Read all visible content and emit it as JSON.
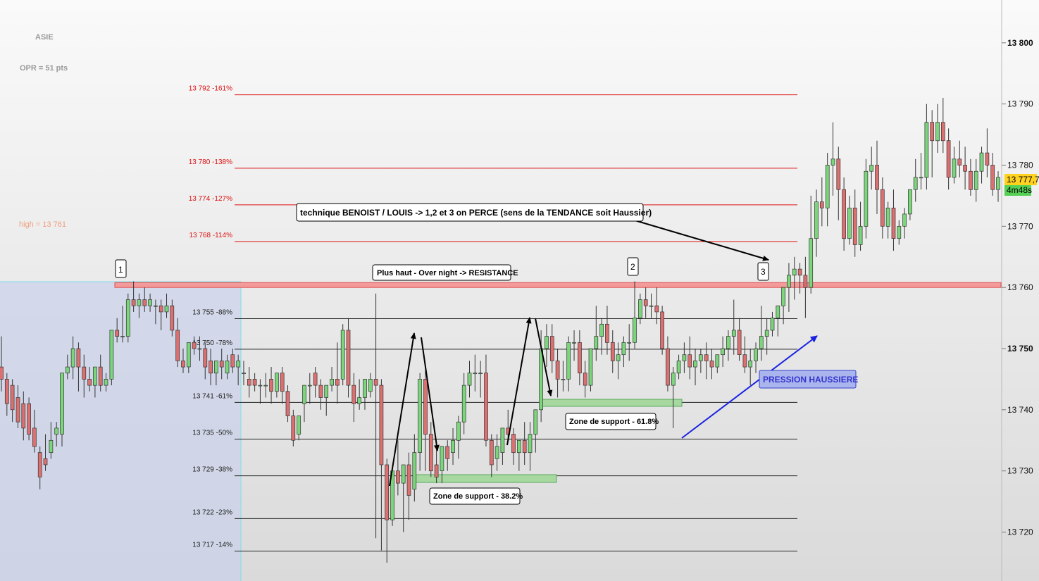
{
  "chart_data": {
    "type": "candlestick",
    "y_axis": {
      "range": [
        13712,
        13807
      ],
      "ticks": [
        {
          "value": 13800,
          "label": "13 800",
          "bold": true
        },
        {
          "value": 13790,
          "label": "13 790",
          "bold": false
        },
        {
          "value": 13780,
          "label": "13 780",
          "bold": false
        },
        {
          "value": 13770,
          "label": "13 770",
          "bold": false
        },
        {
          "value": 13760,
          "label": "13 760",
          "bold": false
        },
        {
          "value": 13750,
          "label": "13 750",
          "bold": true
        },
        {
          "value": 13740,
          "label": "13 740",
          "bold": false
        },
        {
          "value": 13730,
          "label": "13 730",
          "bold": false
        },
        {
          "value": 13720,
          "label": "13 720",
          "bold": false
        }
      ]
    },
    "session_label": "ASIE",
    "opr_label": "OPR = 51 pts",
    "high_label": "high = 13 761",
    "current_price": {
      "label": "13 777,7",
      "value": 13777.7
    },
    "countdown": "4m48s",
    "resistance_level": 13760.4,
    "levels": [
      {
        "label": "13 792 -161%",
        "value": 13791.5,
        "color": "red"
      },
      {
        "label": "13 780 -138%",
        "value": 13779.5,
        "color": "red"
      },
      {
        "label": "13 774 -127%",
        "value": 13773.5,
        "color": "red"
      },
      {
        "label": "13 768 -114%",
        "value": 13767.5,
        "color": "red"
      },
      {
        "label": "13 755 -88%",
        "value": 13754.9,
        "color": "black"
      },
      {
        "label": "13 750 -78%",
        "value": 13749.9,
        "color": "black"
      },
      {
        "label": "13 741 -61%",
        "value": 13741.2,
        "color": "black"
      },
      {
        "label": "13 735 -50%",
        "value": 13735.2,
        "color": "black"
      },
      {
        "label": "13 729 -38%",
        "value": 13729.2,
        "color": "black"
      },
      {
        "label": "13 722 -23%",
        "value": 13722.2,
        "color": "black"
      },
      {
        "label": "13 717 -14%",
        "value": 13716.9,
        "color": "black"
      }
    ],
    "annotations": {
      "technique": "technique BENOIST / LOUIS  -> 1,2 et 3 on PERCE (sens de la TENDANCE soit Haussier)",
      "resistance": "Plus haut - Over night -> RESISTANCE",
      "support_618": "Zone de support - 61.8%",
      "support_382": "Zone de support - 38.2%",
      "pression": "PRESSION HAUSSIERE",
      "markers": [
        "1",
        "2",
        "3"
      ]
    },
    "candles": [
      [
        13747,
        13752,
        13745,
        13743
      ],
      [
        13745,
        13746,
        13741,
        13739
      ],
      [
        13744,
        13745,
        13740,
        13738
      ],
      [
        13742,
        13744,
        13738,
        13737
      ],
      [
        13741,
        13743,
        13737,
        13735
      ],
      [
        13741,
        13742,
        13736,
        13735
      ],
      [
        13737,
        13740,
        13734,
        13733
      ],
      [
        13733,
        13734,
        13729,
        13727
      ],
      [
        13732,
        13736,
        13731,
        13730
      ],
      [
        13733,
        13738,
        13735,
        13732
      ],
      [
        13736,
        13738,
        13737,
        13734
      ],
      [
        13736,
        13742,
        13746,
        13734
      ],
      [
        13746,
        13749,
        13747,
        13745
      ],
      [
        13747,
        13752,
        13750,
        13745
      ],
      [
        13750,
        13751,
        13747,
        13743
      ],
      [
        13747,
        13749,
        13745,
        13742
      ],
      [
        13745,
        13747,
        13744,
        13743
      ],
      [
        13744,
        13746,
        13747,
        13742
      ],
      [
        13747,
        13749,
        13744,
        13743
      ],
      [
        13744,
        13746,
        13745,
        13743
      ],
      [
        13745,
        13753,
        13753,
        13744
      ],
      [
        13753,
        13755,
        13752,
        13751
      ],
      [
        13752,
        13757,
        13752,
        13751
      ],
      [
        13752,
        13759,
        13758,
        13751
      ],
      [
        13758,
        13761,
        13757,
        13756
      ],
      [
        13757,
        13759,
        13758,
        13755
      ],
      [
        13758,
        13760,
        13757,
        13756
      ],
      [
        13757,
        13759,
        13758,
        13756
      ],
      [
        13757,
        13758,
        13757,
        13754
      ],
      [
        13757,
        13758,
        13756,
        13753
      ],
      [
        13756,
        13759,
        13757,
        13755
      ],
      [
        13757,
        13758,
        13753,
        13752
      ],
      [
        13753,
        13755,
        13748,
        13747
      ],
      [
        13748,
        13750,
        13747,
        13746
      ],
      [
        13747,
        13751,
        13751,
        13746
      ],
      [
        13751,
        13752,
        13750,
        13749
      ],
      [
        13750,
        13752,
        13750,
        13748
      ],
      [
        13750,
        13751,
        13747,
        13745
      ],
      [
        13748,
        13750,
        13746,
        13744
      ],
      [
        13746,
        13747,
        13748,
        13744
      ],
      [
        13748,
        13750,
        13747,
        13745
      ],
      [
        13746,
        13749,
        13748,
        13745
      ],
      [
        13749,
        13750,
        13747,
        13746
      ],
      [
        13747,
        13749,
        13748,
        13744
      ],
      [
        13746,
        13748,
        13746,
        13744
      ],
      [
        13745,
        13747,
        13744,
        13742
      ],
      [
        13745,
        13746,
        13744,
        13743
      ],
      [
        13744,
        13745,
        13744,
        13741
      ],
      [
        13744,
        13746,
        13744,
        13742
      ],
      [
        13745,
        13747,
        13743,
        13741
      ],
      [
        13743,
        13746,
        13746,
        13742
      ],
      [
        13746,
        13747,
        13743,
        13741
      ],
      [
        13743,
        13744,
        13739,
        13738
      ],
      [
        13739,
        13740,
        13735,
        13734
      ],
      [
        13736,
        13739,
        13739,
        13735
      ],
      [
        13741,
        13742,
        13744,
        13738
      ],
      [
        13744,
        13746,
        13744,
        13741
      ],
      [
        13746,
        13747,
        13744,
        13742
      ],
      [
        13744,
        13745,
        13742,
        13740
      ],
      [
        13742,
        13744,
        13744,
        13739
      ],
      [
        13744,
        13747,
        13745,
        13743
      ],
      [
        13745,
        13751,
        13744,
        13741
      ],
      [
        13745,
        13754,
        13753,
        13744
      ],
      [
        13753,
        13755,
        13744,
        13742
      ],
      [
        13744,
        13746,
        13741,
        13738
      ],
      [
        13741,
        13745,
        13742,
        13740
      ],
      [
        13742,
        13744,
        13745,
        13740
      ],
      [
        13743,
        13746,
        13745,
        13742
      ],
      [
        13745,
        13759,
        13744,
        13719
      ],
      [
        13744,
        13745,
        13731,
        13717
      ],
      [
        13731,
        13732,
        13722,
        13715
      ],
      [
        13722,
        13729,
        13730,
        13721
      ],
      [
        13730,
        13735,
        13728,
        13726
      ],
      [
        13728,
        13730,
        13731,
        13720
      ],
      [
        13731,
        13733,
        13726,
        13722
      ],
      [
        13727,
        13736,
        13733,
        13725
      ],
      [
        13733,
        13746,
        13745,
        13730
      ],
      [
        13745,
        13747,
        13736,
        13730
      ],
      [
        13736,
        13738,
        13730,
        13729
      ],
      [
        13731,
        13734,
        13729,
        13728
      ],
      [
        13730,
        13733,
        13734,
        13728
      ],
      [
        13734,
        13735,
        13732,
        13730
      ],
      [
        13733,
        13737,
        13735,
        13731
      ],
      [
        13735,
        13739,
        13738,
        13732
      ],
      [
        13738,
        13746,
        13744,
        13736
      ],
      [
        13744,
        13748,
        13746,
        13742
      ],
      [
        13746,
        13749,
        13746,
        13743
      ],
      [
        13746,
        13748,
        13746,
        13742
      ],
      [
        13746,
        13749,
        13735,
        13734
      ],
      [
        13735,
        13736,
        13731,
        13729
      ],
      [
        13732,
        13736,
        13734,
        13730
      ],
      [
        13733,
        13736,
        13737,
        13731
      ],
      [
        13737,
        13740,
        13736,
        13735
      ],
      [
        13736,
        13737,
        13733,
        13731
      ],
      [
        13733,
        13735,
        13735,
        13730
      ],
      [
        13735,
        13738,
        13733,
        13731
      ],
      [
        13733,
        13738,
        13736,
        13730
      ],
      [
        13736,
        13740,
        13740,
        13733
      ],
      [
        13740,
        13753,
        13750,
        13738
      ],
      [
        13750,
        13754,
        13752,
        13747
      ],
      [
        13752,
        13754,
        13748,
        13746
      ],
      [
        13748,
        13750,
        13745,
        13742
      ],
      [
        13745,
        13748,
        13745,
        13743
      ],
      [
        13745,
        13752,
        13751,
        13743
      ],
      [
        13751,
        13753,
        13751,
        13748
      ],
      [
        13751,
        13753,
        13746,
        13744
      ],
      [
        13746,
        13748,
        13744,
        13742
      ],
      [
        13744,
        13747,
        13750,
        13743
      ],
      [
        13750,
        13757,
        13752,
        13748
      ],
      [
        13752,
        13755,
        13754,
        13749
      ],
      [
        13754,
        13757,
        13751,
        13749
      ],
      [
        13751,
        13753,
        13748,
        13746
      ],
      [
        13748,
        13751,
        13749,
        13745
      ],
      [
        13749,
        13752,
        13751,
        13747
      ],
      [
        13751,
        13754,
        13751,
        13748
      ],
      [
        13751,
        13761,
        13755,
        13750
      ],
      [
        13755,
        13759,
        13758,
        13754
      ],
      [
        13758,
        13760,
        13757,
        13755
      ],
      [
        13757,
        13759,
        13757,
        13755
      ],
      [
        13757,
        13760,
        13756,
        13754
      ],
      [
        13756,
        13757,
        13750,
        13749
      ],
      [
        13750,
        13752,
        13744,
        13743
      ],
      [
        13744,
        13747,
        13746,
        13737
      ],
      [
        13746,
        13749,
        13748,
        13745
      ],
      [
        13748,
        13751,
        13749,
        13746
      ],
      [
        13749,
        13752,
        13747,
        13745
      ],
      [
        13747,
        13750,
        13748,
        13744
      ],
      [
        13748,
        13750,
        13749,
        13746
      ],
      [
        13749,
        13751,
        13748,
        13745
      ],
      [
        13748,
        13750,
        13747,
        13745
      ],
      [
        13747,
        13749,
        13749,
        13746
      ],
      [
        13749,
        13752,
        13750,
        13747
      ],
      [
        13750,
        13753,
        13752,
        13748
      ],
      [
        13752,
        13758,
        13753,
        13749
      ],
      [
        13753,
        13755,
        13749,
        13748
      ],
      [
        13749,
        13752,
        13747,
        13746
      ],
      [
        13747,
        13750,
        13748,
        13744
      ],
      [
        13748,
        13751,
        13750,
        13746
      ],
      [
        13750,
        13757,
        13752,
        13748
      ],
      [
        13752,
        13755,
        13753,
        13749
      ],
      [
        13753,
        13756,
        13755,
        13752
      ],
      [
        13755,
        13757,
        13757,
        13752
      ],
      [
        13757,
        13760,
        13760,
        13754
      ],
      [
        13760,
        13764,
        13762,
        13756
      ],
      [
        13762,
        13765,
        13763,
        13758
      ],
      [
        13763,
        13764,
        13762,
        13759
      ],
      [
        13762,
        13765,
        13760,
        13755
      ],
      [
        13760,
        13775,
        13768,
        13759
      ],
      [
        13768,
        13776,
        13774,
        13765
      ],
      [
        13774,
        13778,
        13773,
        13770
      ],
      [
        13773,
        13782,
        13780,
        13770
      ],
      [
        13780,
        13787,
        13781,
        13775
      ],
      [
        13781,
        13783,
        13776,
        13771
      ],
      [
        13776,
        13778,
        13768,
        13766
      ],
      [
        13768,
        13775,
        13773,
        13767
      ],
      [
        13773,
        13776,
        13767,
        13765
      ],
      [
        13767,
        13774,
        13770,
        13766
      ],
      [
        13770,
        13781,
        13779,
        13768
      ],
      [
        13779,
        13783,
        13780,
        13776
      ],
      [
        13780,
        13784,
        13776,
        13772
      ],
      [
        13776,
        13778,
        13770,
        13768
      ],
      [
        13770,
        13774,
        13773,
        13768
      ],
      [
        13773,
        13776,
        13768,
        13766
      ],
      [
        13768,
        13771,
        13770,
        13767
      ],
      [
        13770,
        13773,
        13772,
        13768
      ],
      [
        13772,
        13776,
        13776,
        13771
      ],
      [
        13776,
        13781,
        13778,
        13774
      ],
      [
        13778,
        13782,
        13778,
        13776
      ],
      [
        13778,
        13790,
        13787,
        13776
      ],
      [
        13787,
        13789,
        13784,
        13778
      ],
      [
        13784,
        13790,
        13787,
        13782
      ],
      [
        13787,
        13791,
        13784,
        13782
      ],
      [
        13784,
        13786,
        13778,
        13776
      ],
      [
        13778,
        13783,
        13781,
        13777
      ],
      [
        13781,
        13784,
        13780,
        13778
      ],
      [
        13780,
        13783,
        13779,
        13776
      ],
      [
        13779,
        13781,
        13776,
        13775
      ],
      [
        13776,
        13781,
        13779,
        13774
      ],
      [
        13779,
        13783,
        13782,
        13777
      ],
      [
        13782,
        13786,
        13780,
        13778
      ],
      [
        13780,
        13782,
        13776,
        13775
      ],
      [
        13776,
        13779,
        13778,
        13774
      ]
    ]
  }
}
